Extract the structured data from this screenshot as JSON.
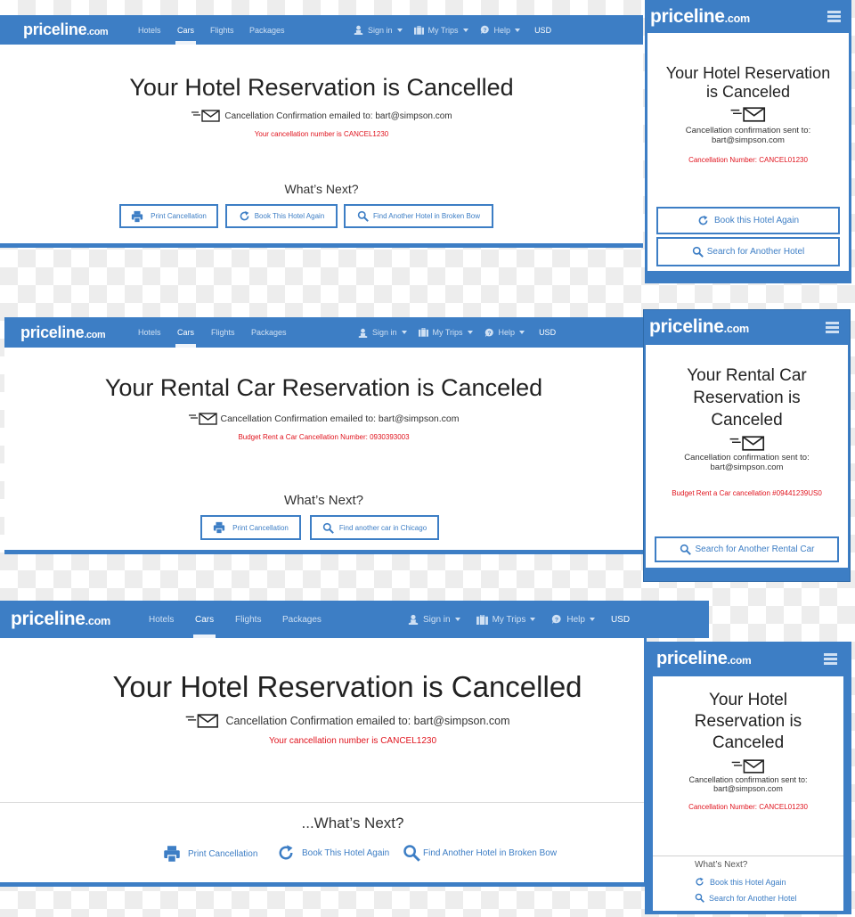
{
  "brand": {
    "logo_main": "priceline",
    "logo_suffix": ".com",
    "accent_color": "#3d7ec5",
    "alert_color": "#e0141e"
  },
  "nav": {
    "links": [
      "Hotels",
      "Cars",
      "Flights",
      "Packages"
    ],
    "active": "Cars",
    "sign_in": "Sign in",
    "my_trips": "My Trips",
    "help": "Help",
    "currency": "USD"
  },
  "panels": {
    "desktop_hotel_1": {
      "title": "Your Hotel Reservation is Cancelled",
      "email_text": "Cancellation Confirmation emailed to: bart@simpson.com",
      "cancel_text": "Your cancellation number is CANCEL1230",
      "next_heading": "What’s Next?",
      "buttons": [
        "Print Cancellation",
        "Book This Hotel Again",
        "Find Another Hotel in Broken Bow"
      ]
    },
    "mobile_hotel_1": {
      "title": "Your Hotel Reservation is Canceled",
      "email_label": "Cancellation confirmation sent to:",
      "email": "bart@simpson.com",
      "cancel_text": "Cancellation Number: CANCEL01230",
      "buttons": [
        "Book this Hotel Again",
        "Search for Another Hotel"
      ]
    },
    "desktop_car": {
      "title": "Your Rental Car Reservation is Canceled",
      "email_text": "Cancellation Confirmation emailed to: bart@simpson.com",
      "cancel_text": "Budget Rent a Car Cancellation Number: 0930393003",
      "next_heading": "What’s Next?",
      "buttons": [
        "Print Cancellation",
        "Find another car in Chicago"
      ]
    },
    "mobile_car": {
      "title_lines": [
        "Your Rental Car",
        "Reservation is",
        "Canceled"
      ],
      "email_label": "Cancellation confirmation sent to:",
      "email": "bart@simpson.com",
      "cancel_text": "Budget Rent a Car cancellation #09441239US0",
      "buttons": [
        "Search for Another Rental Car"
      ]
    },
    "desktop_hotel_2": {
      "title": "Your Hotel Reservation is Cancelled",
      "email_text": "Cancellation Confirmation emailed to: bart@simpson.com",
      "cancel_text": "Your cancellation number is CANCEL1230",
      "next_heading": "...What’s Next?",
      "links": [
        "Print Cancellation",
        "Book This Hotel Again",
        "Find Another Hotel in Broken Bow"
      ]
    },
    "mobile_hotel_2": {
      "title_lines": [
        "Your Hotel",
        "Reservation is",
        "Canceled"
      ],
      "email_label": "Cancellation confirmation sent to:",
      "email": "bart@simpson.com",
      "cancel_text": "Cancellation Number: CANCEL01230",
      "next_heading": "What’s Next?",
      "links": [
        "Book this Hotel Again",
        "Search for Another Hotel"
      ]
    }
  }
}
